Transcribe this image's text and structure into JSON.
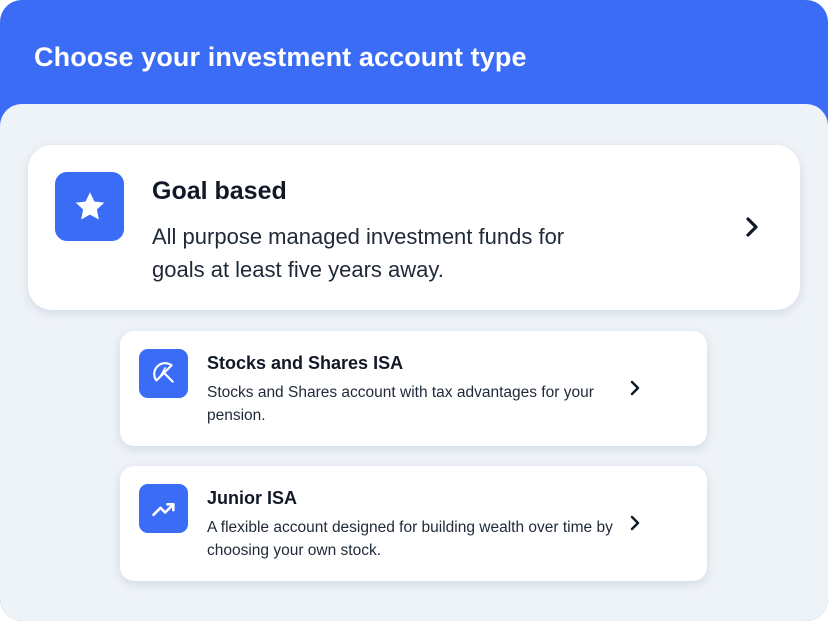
{
  "header": {
    "title": "Choose your investment account type"
  },
  "options": [
    {
      "title": "Goal based",
      "description": "All purpose managed investment funds for goals at least five years away.",
      "icon": "star-icon"
    },
    {
      "title": "Stocks and Shares ISA",
      "description": "Stocks and Shares account with tax advantages for your pension.",
      "icon": "umbrella-icon"
    },
    {
      "title": "Junior ISA",
      "description": "A flexible account designed for building wealth over time by choosing your own stock.",
      "icon": "trend-up-icon"
    }
  ],
  "colors": {
    "accent": "#3b6cf6",
    "background": "#eef3f8",
    "card": "#ffffff",
    "text": "#111827"
  }
}
